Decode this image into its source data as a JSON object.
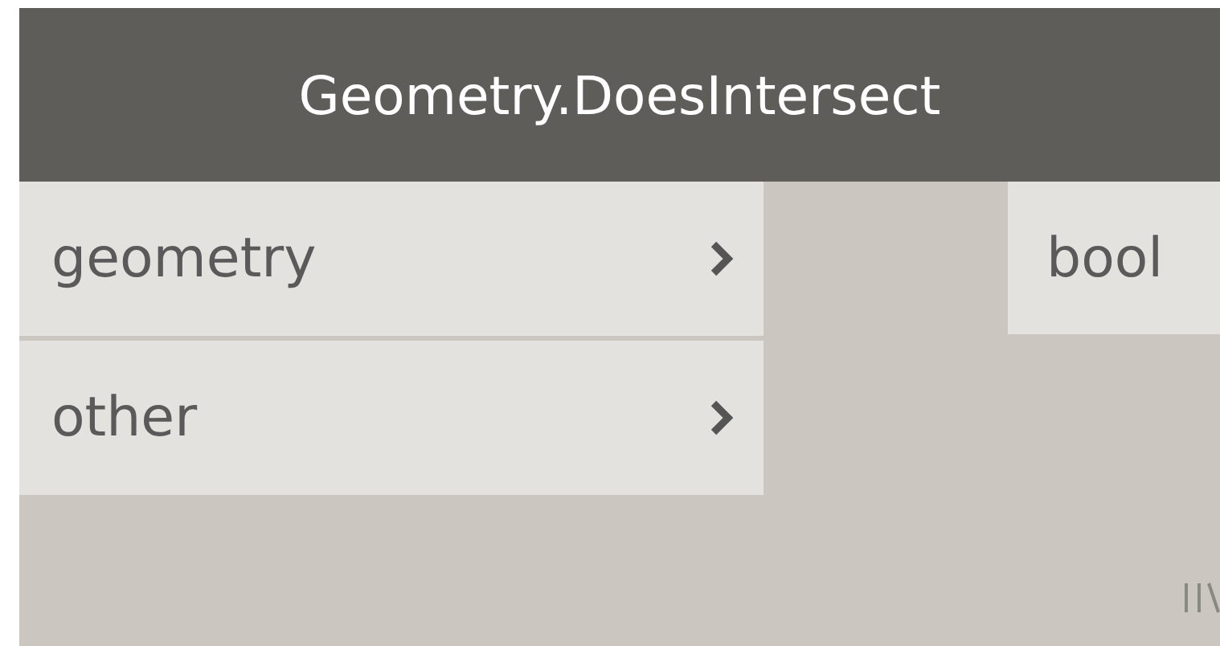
{
  "node": {
    "title": "Geometry.DoesIntersect",
    "inputs": [
      {
        "name": "geometry"
      },
      {
        "name": "other"
      }
    ],
    "outputs": [
      {
        "name": "bool"
      }
    ]
  }
}
